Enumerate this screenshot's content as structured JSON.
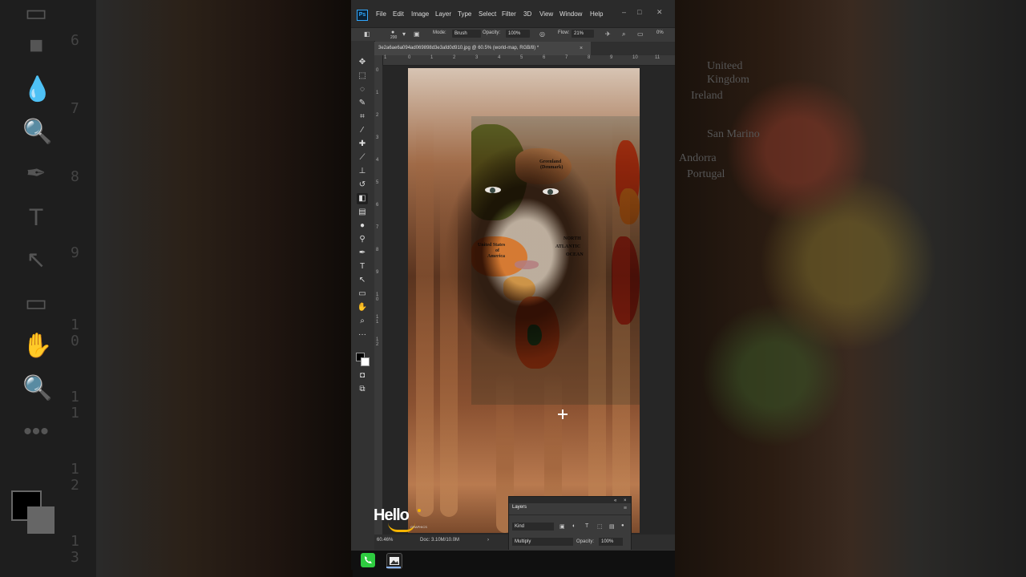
{
  "menu": {
    "logo": "Ps",
    "items": [
      "File",
      "Edit",
      "Image",
      "Layer",
      "Type",
      "Select",
      "Filter",
      "3D",
      "View",
      "Window",
      "Help"
    ]
  },
  "window_controls": {
    "minimize": "–",
    "maximize": "□",
    "close": "✕"
  },
  "options_bar": {
    "brush_size": "200",
    "mode_label": "Mode:",
    "mode_value": "Brush",
    "opacity_label": "Opacity:",
    "opacity_value": "100%",
    "flow_label": "Flow:",
    "flow_value": "21%",
    "angle_value": "0%"
  },
  "document_tab": {
    "title": "3e2a6ae6a094ad069898d3e3afd0d910.jpg @ 60.5% (world-map, RGB/8) *",
    "close": "×"
  },
  "ruler_h_ticks": [
    "1",
    "0",
    "1",
    "2",
    "3",
    "4",
    "5",
    "6",
    "7",
    "8",
    "9",
    "10",
    "11"
  ],
  "ruler_v_ticks": [
    "0",
    "1",
    "2",
    "3",
    "4",
    "5",
    "6",
    "7",
    "8",
    "9",
    "1 0",
    "1 1",
    "1 2"
  ],
  "map_labels": {
    "greenland": "Greenland",
    "denmark": "(Denmark)",
    "united_states": "United States",
    "of": "of",
    "america": "America",
    "north": "NORTH",
    "atlantic": "ATLANTIC",
    "ocean": "OCEAN"
  },
  "status": {
    "zoom": "60.46%",
    "doc": "Doc: 3.10M/10.0M",
    "arrow": "›"
  },
  "layers_panel": {
    "tab_label": "Layers",
    "filter_kind": "Kind",
    "blend_mode": "Multiply",
    "opacity_label": "Opacity:",
    "opacity_value": "100%"
  },
  "watermark": {
    "text": "Hello",
    "subtext": "GRAPHICS"
  },
  "ghost_left_ruler": [
    "6",
    "7",
    "8",
    "9",
    "1",
    "0",
    "1",
    "1",
    "1",
    "2",
    "1",
    "3"
  ],
  "ghost_right_text": [
    "Uniteed",
    "Kingdom",
    "Ireland",
    "Andorra",
    "Portugal",
    "San Marino"
  ],
  "colors": {
    "accent_blue": "#31a8ff",
    "panel_dark": "#323232",
    "canvas_bg": "#535353",
    "watermark_yellow": "#f5b400"
  }
}
